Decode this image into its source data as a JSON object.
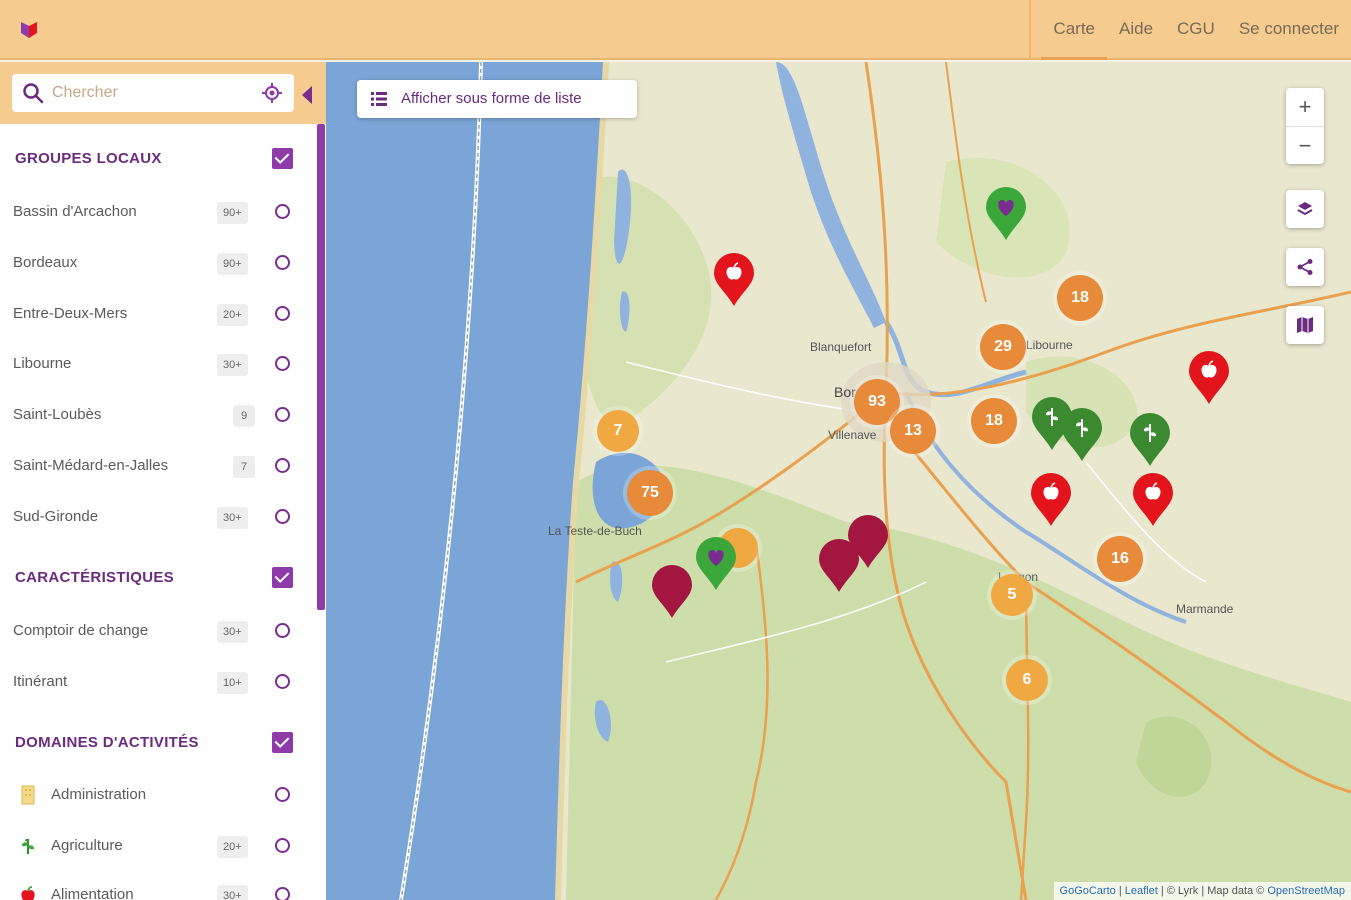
{
  "nav": {
    "items": [
      "Carte",
      "Aide",
      "CGU",
      "Se connecter"
    ]
  },
  "search": {
    "placeholder": "Chercher"
  },
  "sidebar": {
    "groups_title": "GROUPES LOCAUX",
    "groups": [
      {
        "label": "Bassin d'Arcachon",
        "count": "90+"
      },
      {
        "label": "Bordeaux",
        "count": "90+"
      },
      {
        "label": "Entre-Deux-Mers",
        "count": "20+"
      },
      {
        "label": "Libourne",
        "count": "30+"
      },
      {
        "label": "Saint-Loubès",
        "count": "9"
      },
      {
        "label": "Saint-Médard-en-Jalles",
        "count": "7"
      },
      {
        "label": "Sud-Gironde",
        "count": "30+"
      }
    ],
    "features_title": "CARACTÉRISTIQUES",
    "features": [
      {
        "label": "Comptoir de change",
        "count": "30+"
      },
      {
        "label": "Itinérant",
        "count": "10+"
      }
    ],
    "domains_title": "DOMAINES D'ACTIVITÉS",
    "domains": [
      {
        "label": "Administration",
        "count": "",
        "icon": "building-icon"
      },
      {
        "label": "Agriculture",
        "count": "20+",
        "icon": "plant-icon"
      },
      {
        "label": "Alimentation",
        "count": "30+",
        "icon": "apple-icon"
      }
    ]
  },
  "map": {
    "list_button": "Afficher sous forme de liste",
    "zoom_in": "+",
    "zoom_out": "−",
    "places": [
      "Blanquefort",
      "Bordeaux",
      "Villenave",
      "La Teste-de-Buch",
      "Langon",
      "Marmande",
      "Libourne"
    ],
    "clusters": [
      {
        "value": "18",
        "tone": "orange"
      },
      {
        "value": "29",
        "tone": "orange"
      },
      {
        "value": "93",
        "tone": "orange"
      },
      {
        "value": "13",
        "tone": "orange"
      },
      {
        "value": "18",
        "tone": "orange"
      },
      {
        "value": "7",
        "tone": "light"
      },
      {
        "value": "75",
        "tone": "orange"
      },
      {
        "value": "16",
        "tone": "orange"
      },
      {
        "value": "5",
        "tone": "light"
      },
      {
        "value": "6",
        "tone": "light"
      }
    ],
    "attribution": {
      "prefix": "",
      "gogocarto": "GoGoCarto",
      "sep1": " | ",
      "leaflet": "Leaflet",
      "middle": " | © Lyrk | Map data © ",
      "osm": "OpenStreetMap"
    },
    "colors": {
      "sea": "#7aa5d6",
      "land": "#e9e7cd",
      "forest": "#c9dca5",
      "river": "#8fb2de",
      "road": "#e9a04f",
      "marker_red": "#e3141b",
      "marker_green": "#3ba63a",
      "marker_crimson": "#a3163f"
    }
  }
}
